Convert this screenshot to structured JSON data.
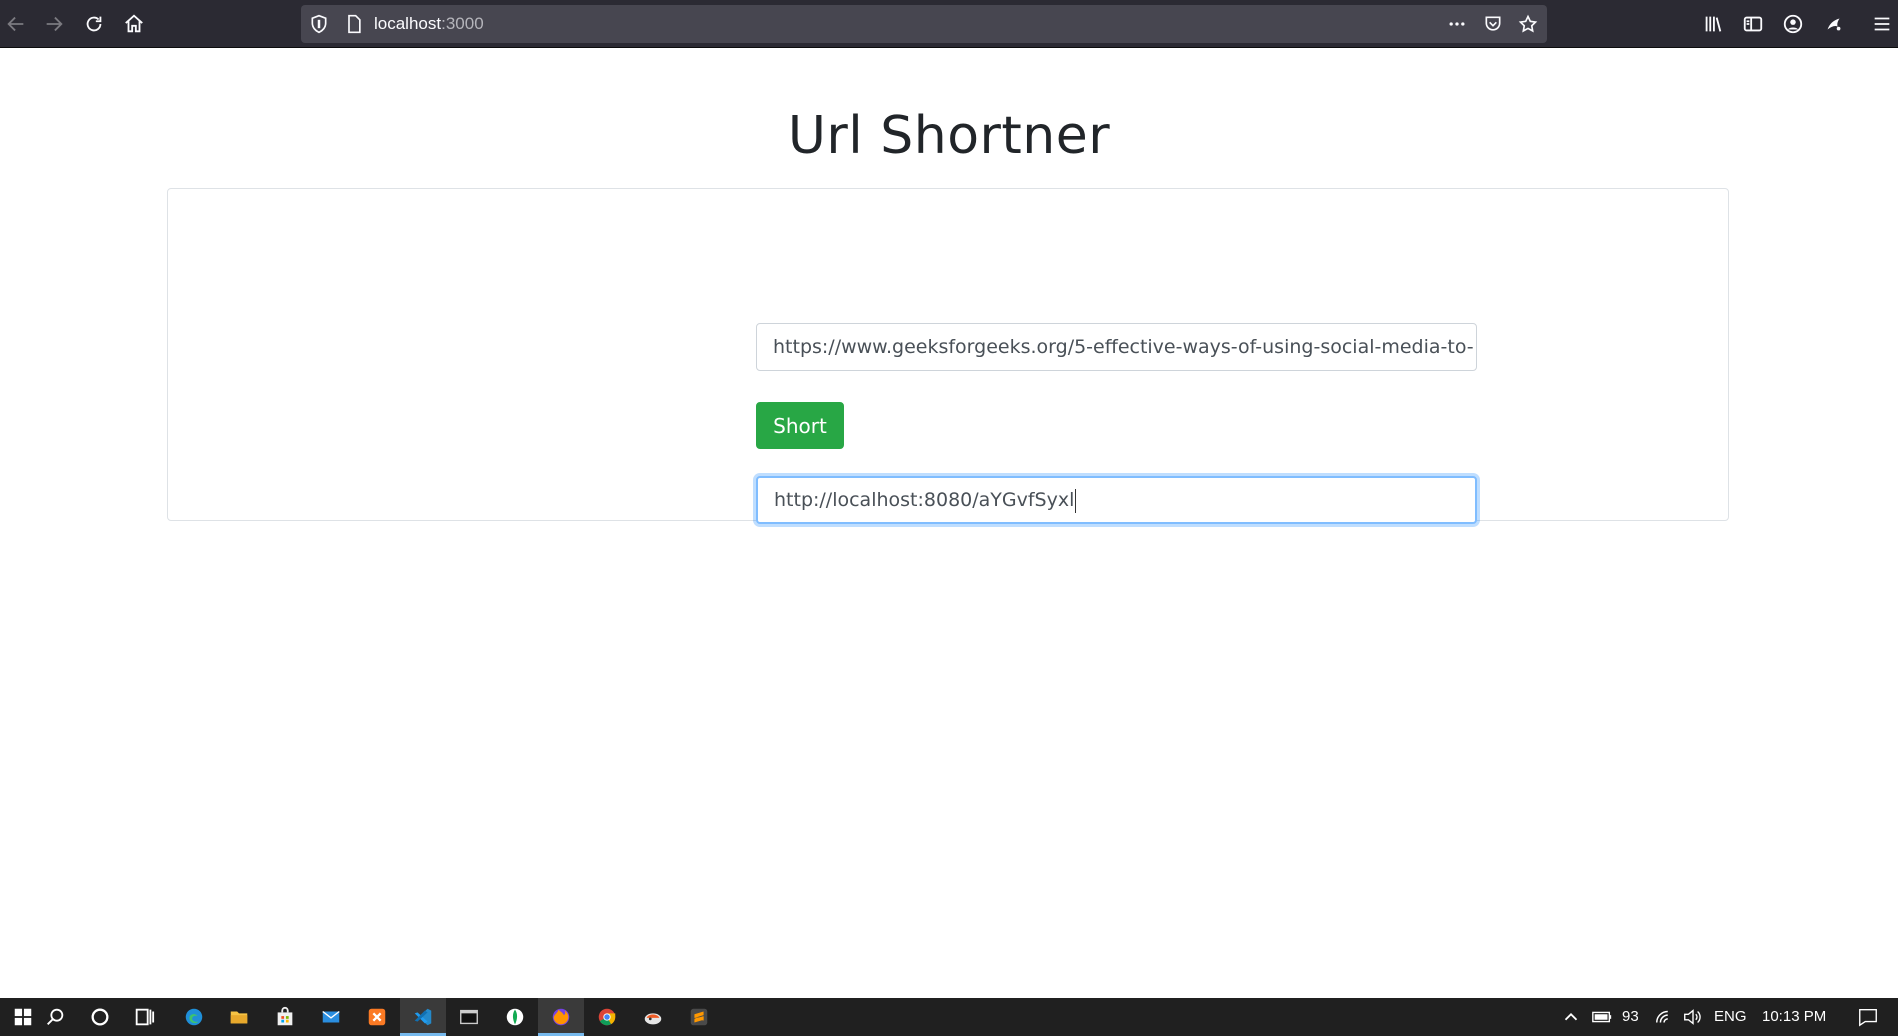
{
  "browser": {
    "url_host": "localhost",
    "url_port": ":3000",
    "icons": {
      "back": "back-arrow-icon",
      "forward": "forward-arrow-icon",
      "reload": "reload-icon",
      "home": "home-icon",
      "tracking": "shield-icon",
      "page": "page-icon",
      "more": "more-icon",
      "pocket": "pocket-icon",
      "bookmark": "star-icon",
      "library": "library-icon",
      "sidebar": "sidebar-icon",
      "account": "account-icon",
      "extension": "extension-icon",
      "menu": "hamburger-menu-icon"
    }
  },
  "page": {
    "title": "Url Shortner",
    "long_url": "https://www.geeksforgeeks.org/5-effective-ways-of-using-social-media-to-",
    "short_button_label": "Short",
    "short_url": "http://localhost:8080/aYGvfSyxl"
  },
  "taskbar": {
    "battery_percent": "93",
    "language": "ENG",
    "time": "10:13 PM",
    "apps": [
      "windows-start-icon",
      "search-icon",
      "cortana-icon",
      "task-view-icon",
      "edge-icon",
      "file-explorer-icon",
      "store-icon",
      "mail-icon",
      "xampp-icon",
      "vscode-icon",
      "terminal-icon",
      "mongodb-compass-icon",
      "firefox-icon",
      "chrome-icon",
      "postman-icon",
      "sublime-text-icon"
    ]
  },
  "colors": {
    "toolbar": "#2b2a33",
    "urlbar": "#474650",
    "button_green": "#28a745",
    "focus_border": "#80bdff",
    "taskbar": "#202020"
  }
}
